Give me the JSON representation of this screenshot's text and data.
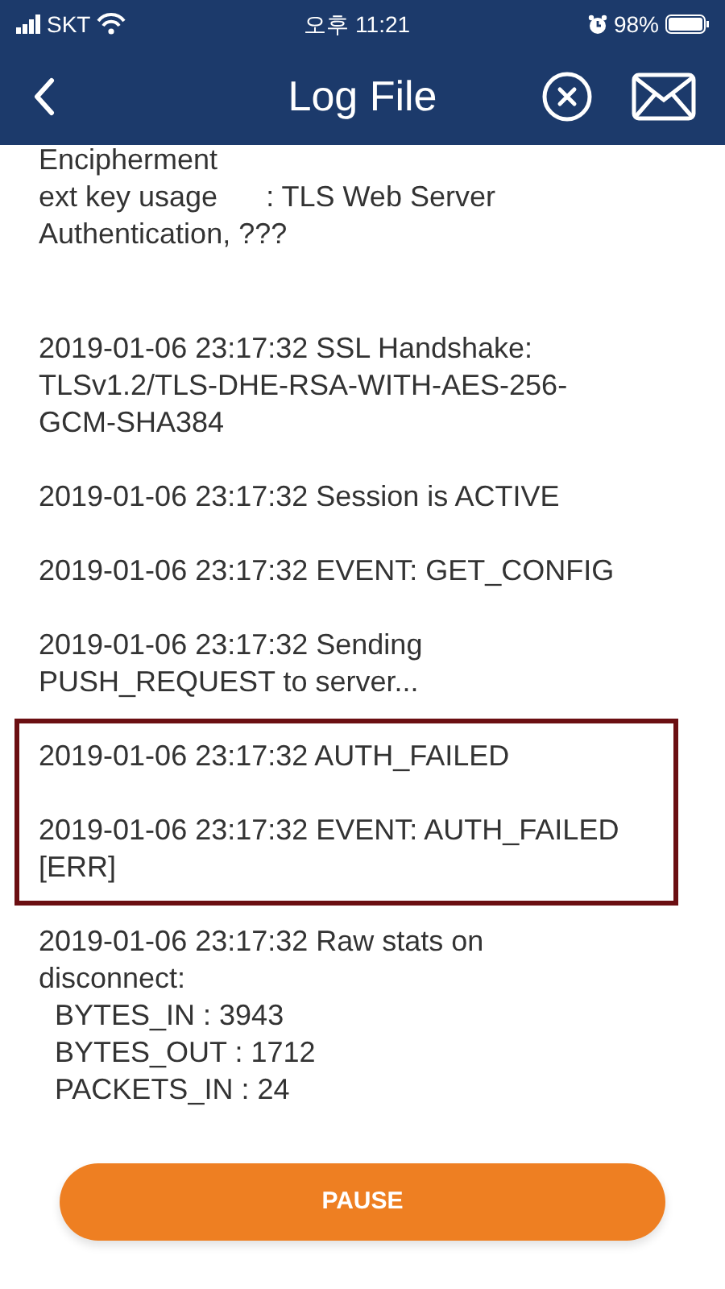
{
  "status_bar": {
    "carrier": "SKT",
    "time": "오후 11:21",
    "battery": "98%"
  },
  "header": {
    "title": "Log File"
  },
  "log": [
    {
      "lines": [
        "Encipherment",
        "ext key usage      : TLS Web Server",
        "Authentication, ???"
      ],
      "highlighted": false
    },
    {
      "lines": [
        "2019-01-06 23:17:32 SSL Handshake:",
        "TLSv1.2/TLS-DHE-RSA-WITH-AES-256-",
        "GCM-SHA384"
      ],
      "highlighted": false
    },
    {
      "lines": [
        "2019-01-06 23:17:32 Session is ACTIVE"
      ],
      "highlighted": false
    },
    {
      "lines": [
        "2019-01-06 23:17:32 EVENT: GET_CONFIG"
      ],
      "highlighted": false
    },
    {
      "lines": [
        "2019-01-06 23:17:32 Sending",
        "PUSH_REQUEST to server..."
      ],
      "highlighted": false
    },
    {
      "lines": [
        "2019-01-06 23:17:32 AUTH_FAILED"
      ],
      "highlighted": true
    },
    {
      "lines": [
        "2019-01-06 23:17:32 EVENT: AUTH_FAILED",
        "[ERR]"
      ],
      "highlighted": true
    },
    {
      "lines": [
        "2019-01-06 23:17:32 Raw stats on",
        "disconnect:",
        "  BYTES_IN : 3943",
        "  BYTES_OUT : 1712",
        "  PACKETS_IN : 24"
      ],
      "highlighted": false
    }
  ],
  "button": {
    "label": "PAUSE"
  }
}
